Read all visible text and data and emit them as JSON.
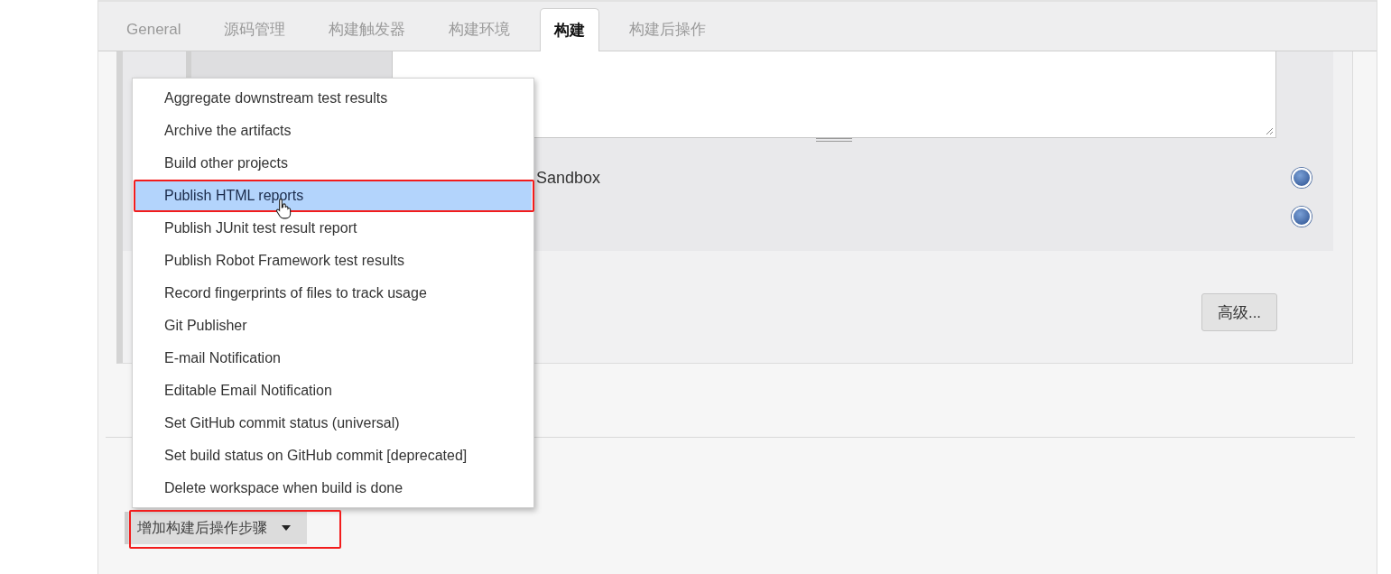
{
  "tabs": [
    {
      "label": "General",
      "selected": false
    },
    {
      "label": "源码管理",
      "selected": false
    },
    {
      "label": "构建触发器",
      "selected": false
    },
    {
      "label": "构建环境",
      "selected": false
    },
    {
      "label": "构建",
      "selected": true
    },
    {
      "label": "构建后操作",
      "selected": false
    }
  ],
  "sandbox_label": "Sandbox",
  "advanced_button": "高级...",
  "menu": {
    "items": [
      {
        "label": "Aggregate downstream test results",
        "selected": false
      },
      {
        "label": "Archive the artifacts",
        "selected": false
      },
      {
        "label": "Build other projects",
        "selected": false
      },
      {
        "label": "Publish HTML reports",
        "selected": true
      },
      {
        "label": "Publish JUnit test result report",
        "selected": false
      },
      {
        "label": "Publish Robot Framework test results",
        "selected": false
      },
      {
        "label": "Record fingerprints of files to track usage",
        "selected": false
      },
      {
        "label": "Git Publisher",
        "selected": false
      },
      {
        "label": "E-mail Notification",
        "selected": false
      },
      {
        "label": "Editable Email Notification",
        "selected": false
      },
      {
        "label": "Set GitHub commit status (universal)",
        "selected": false
      },
      {
        "label": "Set build status on GitHub commit [deprecated]",
        "selected": false
      },
      {
        "label": "Delete workspace when build is done",
        "selected": false
      }
    ]
  },
  "add_step_button": "增加构建后操作步骤"
}
